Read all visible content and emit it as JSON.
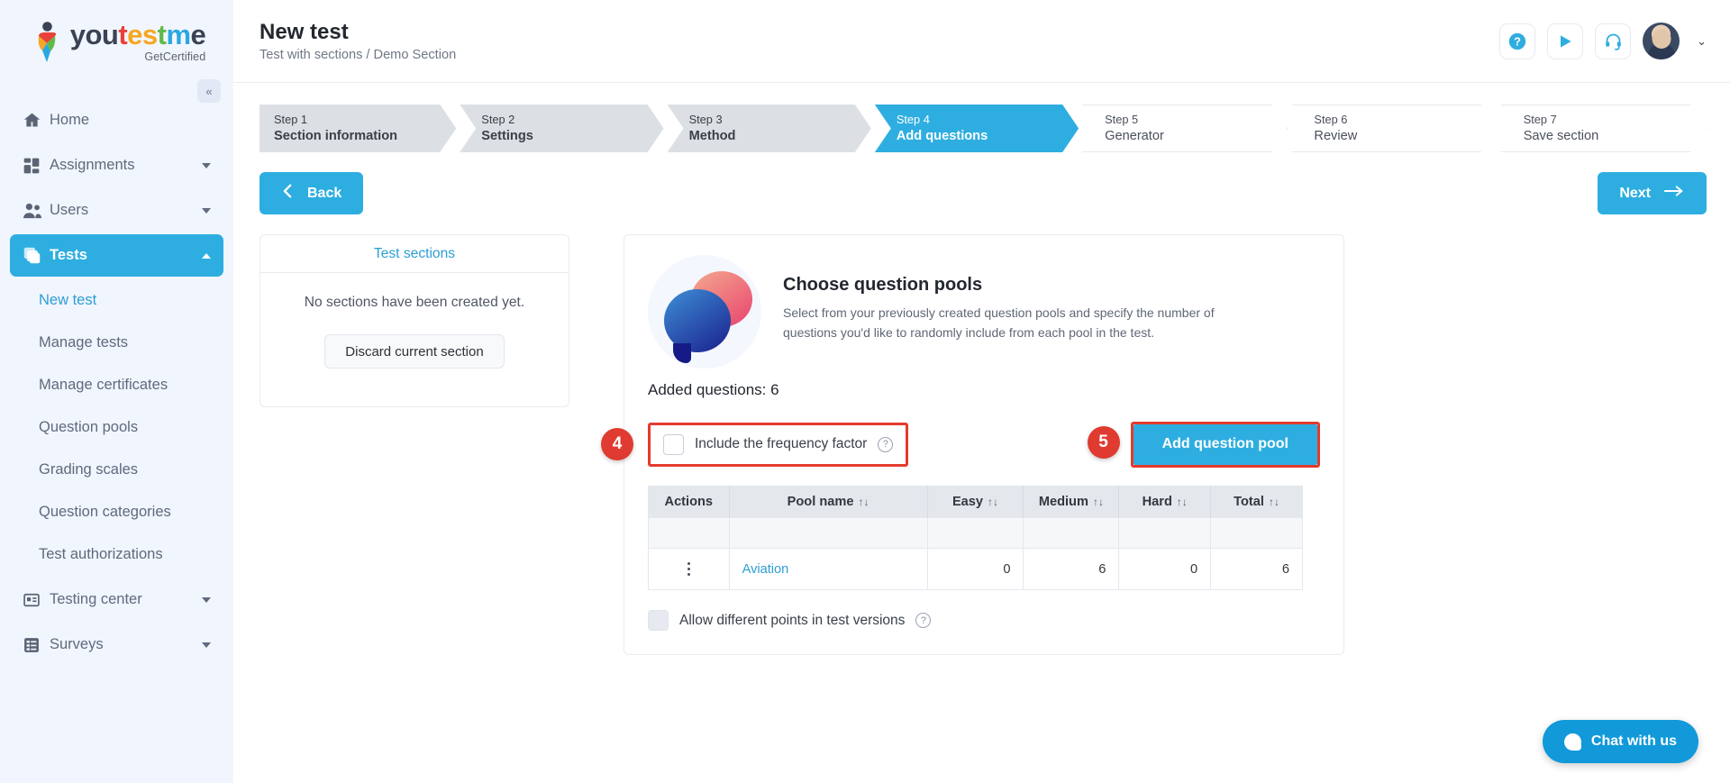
{
  "brand": {
    "word_parts": [
      "you",
      "t",
      "es",
      "t",
      "m",
      "e"
    ],
    "tagline": "GetCertified",
    "accent": "#2eaee0",
    "highlight": "#e33b2e"
  },
  "sidebar": {
    "collapse_label": "«",
    "items": [
      {
        "label": "Home",
        "icon": "home-icon",
        "caret": "",
        "type": "item"
      },
      {
        "label": "Assignments",
        "icon": "assignments-icon",
        "caret": "down",
        "type": "item"
      },
      {
        "label": "Users",
        "icon": "users-icon",
        "caret": "down",
        "type": "item"
      },
      {
        "label": "Tests",
        "icon": "tests-icon",
        "caret": "up",
        "type": "item",
        "active": true
      },
      {
        "label": "New test",
        "type": "sub",
        "current": true
      },
      {
        "label": "Manage tests",
        "type": "sub"
      },
      {
        "label": "Manage certificates",
        "type": "sub"
      },
      {
        "label": "Question pools",
        "type": "sub"
      },
      {
        "label": "Grading scales",
        "type": "sub"
      },
      {
        "label": "Question categories",
        "type": "sub"
      },
      {
        "label": "Test authorizations",
        "type": "sub"
      },
      {
        "label": "Testing center",
        "icon": "testing-center-icon",
        "caret": "down",
        "type": "item"
      },
      {
        "label": "Surveys",
        "icon": "surveys-icon",
        "caret": "down",
        "type": "item"
      }
    ]
  },
  "header": {
    "title": "New test",
    "breadcrumb": "Test with sections / Demo Section",
    "actions": [
      {
        "name": "help-icon",
        "glyph": "?"
      },
      {
        "name": "play-icon",
        "glyph": "▶"
      },
      {
        "name": "headset-support-icon",
        "glyph": "🎧"
      }
    ],
    "avatar_caret": "⌄"
  },
  "stepper": [
    {
      "num": "Step 1",
      "label": "Section information",
      "state": "done"
    },
    {
      "num": "Step 2",
      "label": "Settings",
      "state": "done"
    },
    {
      "num": "Step 3",
      "label": "Method",
      "state": "done"
    },
    {
      "num": "Step 4",
      "label": "Add questions",
      "state": "active"
    },
    {
      "num": "Step 5",
      "label": "Generator",
      "state": "upcoming"
    },
    {
      "num": "Step 6",
      "label": "Review",
      "state": "upcoming"
    },
    {
      "num": "Step 7",
      "label": "Save section",
      "state": "upcoming"
    }
  ],
  "nav_buttons": {
    "back": "Back",
    "next": "Next"
  },
  "sections_panel": {
    "title": "Test sections",
    "empty_text": "No sections have been created yet.",
    "discard_label": "Discard current section"
  },
  "pool_panel": {
    "title": "Choose question pools",
    "description": "Select from your previously created question pools and specify the number of questions you'd like to randomly include from each pool in the test.",
    "added_questions": "Added questions: 6",
    "frequency_checkbox_label": "Include the frequency factor",
    "frequency_checked": false,
    "add_pool_button": "Add question pool",
    "allow_points_label": "Allow different points in test versions",
    "allow_points_checked": false,
    "badges": {
      "four": "4",
      "five": "5"
    },
    "table": {
      "columns": [
        "Actions",
        "Pool name",
        "Easy",
        "Medium",
        "Hard",
        "Total"
      ],
      "sortable": [
        false,
        true,
        true,
        true,
        true,
        true
      ],
      "sort_glyph": "↑↓",
      "rows": [
        {
          "pool_name": "Aviation",
          "easy": "0",
          "medium": "6",
          "hard": "0",
          "total": "6"
        }
      ]
    }
  },
  "chat": {
    "label": "Chat with us"
  }
}
